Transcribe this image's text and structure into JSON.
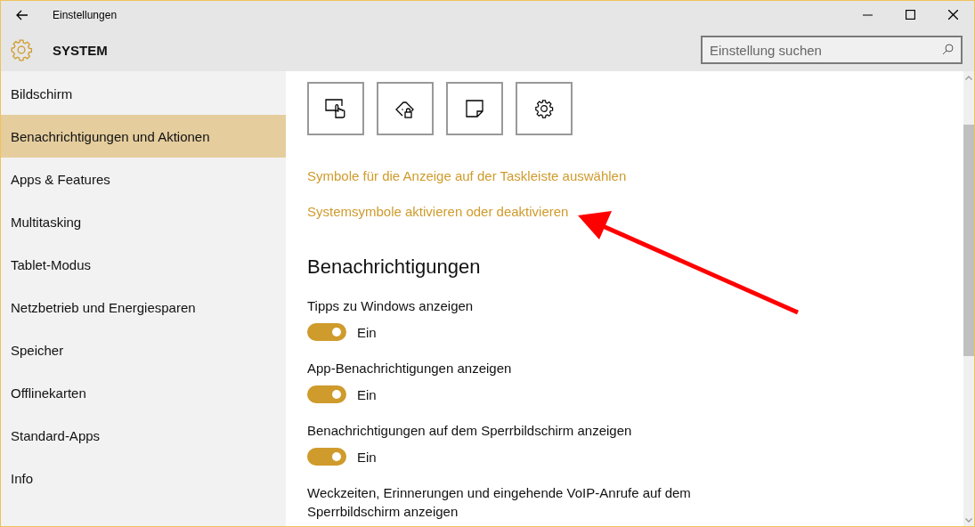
{
  "window": {
    "title": "Einstellungen"
  },
  "header": {
    "title": "SYSTEM",
    "search": {
      "placeholder": "Einstellung suchen"
    }
  },
  "sidebar": {
    "items": [
      {
        "label": "Bildschirm",
        "selected": false
      },
      {
        "label": "Benachrichtigungen und Aktionen",
        "selected": true
      },
      {
        "label": "Apps & Features",
        "selected": false
      },
      {
        "label": "Multitasking",
        "selected": false
      },
      {
        "label": "Tablet-Modus",
        "selected": false
      },
      {
        "label": "Netzbetrieb und Energiesparen",
        "selected": false
      },
      {
        "label": "Speicher",
        "selected": false
      },
      {
        "label": "Offlinekarten",
        "selected": false
      },
      {
        "label": "Standard-Apps",
        "selected": false
      },
      {
        "label": "Info",
        "selected": false
      }
    ]
  },
  "content": {
    "links": [
      "Symbole für die Anzeige auf der Taskleiste auswählen",
      "Systemsymbole aktivieren oder deaktivieren"
    ],
    "section_title": "Benachrichtigungen",
    "settings": [
      {
        "kind": "toggle",
        "label": "Tipps zu Windows anzeigen",
        "on": true,
        "state_label": "Ein"
      },
      {
        "kind": "toggle",
        "label": "App-Benachrichtigungen anzeigen",
        "on": true,
        "state_label": "Ein"
      },
      {
        "kind": "toggle",
        "label": "Benachrichtigungen auf dem Sperrbildschirm anzeigen",
        "on": true,
        "state_label": "Ein"
      },
      {
        "kind": "text",
        "label": "Weckzeiten, Erinnerungen und eingehende VoIP-Anrufe auf dem Sperrbildschirm anzeigen"
      }
    ]
  }
}
